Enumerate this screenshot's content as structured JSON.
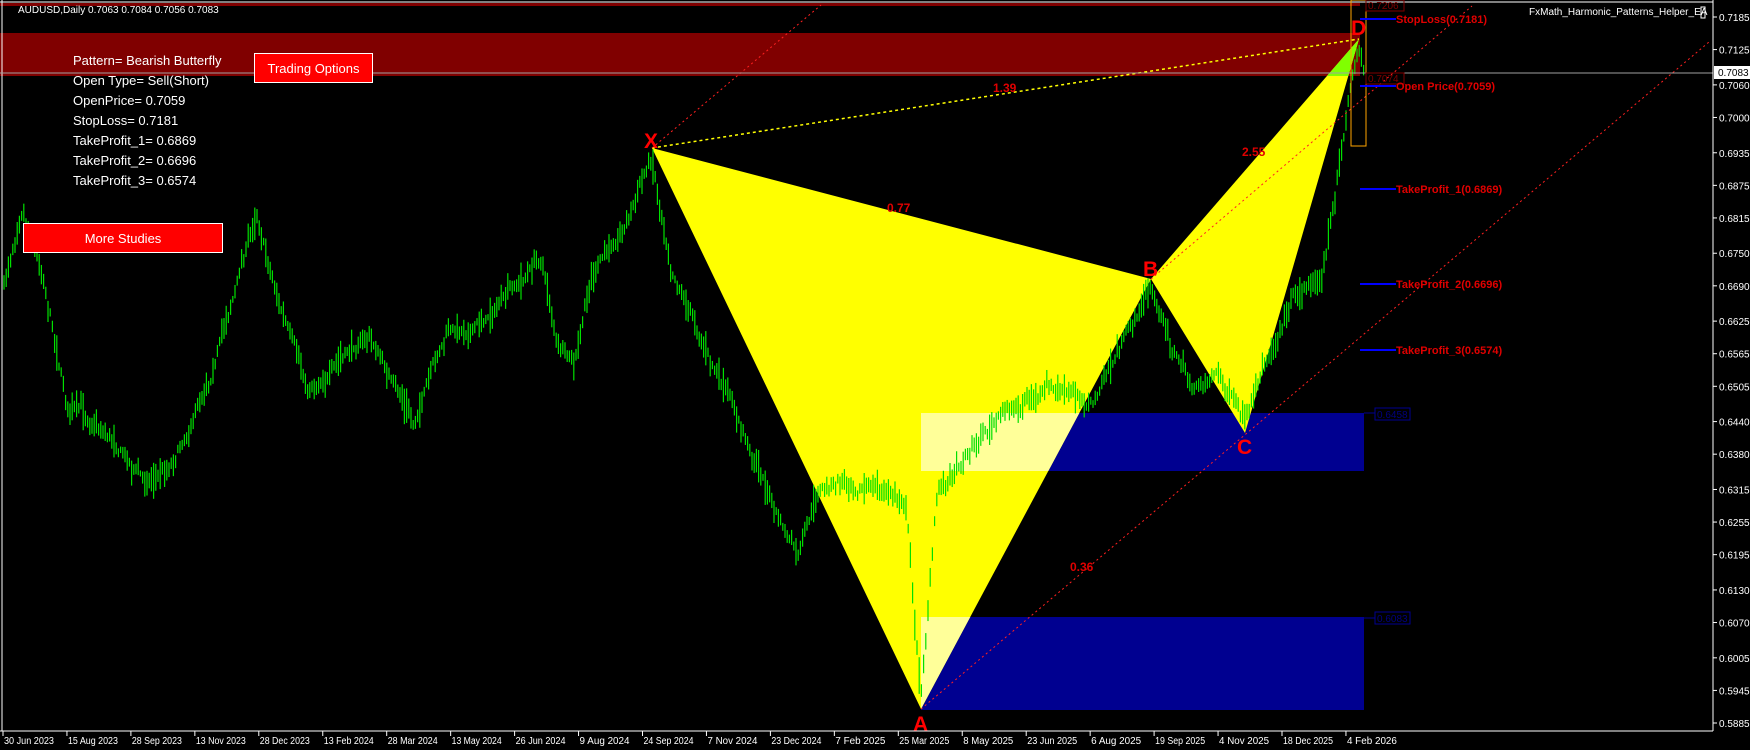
{
  "header": {
    "symbol_info": "AUDUSD,Daily  0.7063 0.7084 0.7056 0.7083",
    "ea_name": "FxMath_Harmonic_Patterns_Helper_EA"
  },
  "info_panel": {
    "lines": [
      "Pattern= Bearish Butterfly",
      "Open Type= Sell(Short)",
      "OpenPrice= 0.7059",
      "StopLoss= 0.7181",
      "TakeProfit_1= 0.6869",
      "TakeProfit_2= 0.6696",
      "TakeProfit_3= 0.6574"
    ]
  },
  "buttons": {
    "trading_options": "Trading Options",
    "more_studies": "More Studies"
  },
  "levels": {
    "stop_loss": "StopLoss(0.7181)",
    "open_price": "Open Price(0.7059)",
    "tp1": "TakeProfit_1(0.6869)",
    "tp2": "TakeProfit_2(0.6696)",
    "tp3": "TakeProfit_3(0.6574)"
  },
  "zone_labels": {
    "upper_top": "0.7206",
    "upper_bottom": "0.7074",
    "box1": "0.6458",
    "box2": "0.6083"
  },
  "pattern_points": {
    "x": "X",
    "a": "A",
    "b": "B",
    "c": "C",
    "d": "D"
  },
  "ratios": {
    "xb": "0.77",
    "xd": "1.39",
    "bd": "2.55",
    "ac": "0.36"
  },
  "price_axis": {
    "ticks": [
      "0.7185",
      "0.7125",
      "0.7060",
      "0.7000",
      "0.6935",
      "0.6875",
      "0.6815",
      "0.6750",
      "0.6690",
      "0.6625",
      "0.6565",
      "0.6505",
      "0.6440",
      "0.6380",
      "0.6315",
      "0.6255",
      "0.6195",
      "0.6130",
      "0.6070",
      "0.6005",
      "0.5945",
      "0.5885"
    ],
    "current_price": "0.7083"
  },
  "time_axis": {
    "ticks": [
      "30 Jun 2023",
      "15 Aug 2023",
      "28 Sep 2023",
      "13 Nov 2023",
      "28 Dec 2023",
      "13 Feb 2024",
      "28 Mar 2024",
      "13 May 2024",
      "26 Jun 2024",
      "9 Aug 2024",
      "24 Sep 2024",
      "7 Nov 2024",
      "23 Dec 2024",
      "7 Feb 2025",
      "25 Mar 2025",
      "8 May 2025",
      "23 Jun 2025",
      "6 Aug 2025",
      "19 Sep 2025",
      "4 Nov 2025",
      "18 Dec 2025",
      "4 Feb 2026"
    ]
  },
  "colors": {
    "background": "#000000",
    "candles": "#00e000",
    "pattern_fill": "#ffff00",
    "zone_red": "#800000",
    "zone_blue": "#000090",
    "level_text": "#e00000",
    "level_line": "#0000ff"
  }
}
